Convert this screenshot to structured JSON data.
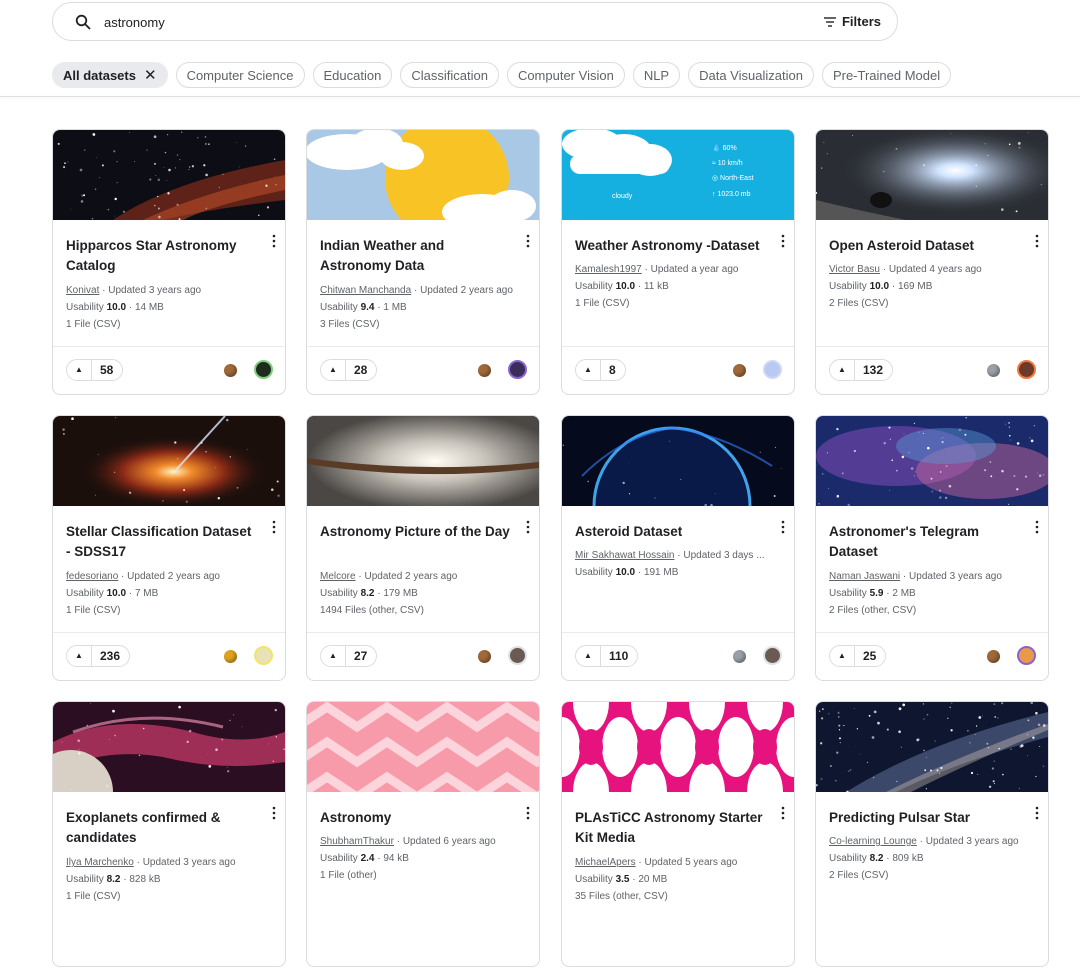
{
  "search": {
    "query": "astronomy",
    "filters_label": "Filters"
  },
  "chips": [
    {
      "label": "All datasets",
      "active": true
    },
    {
      "label": "Computer Science"
    },
    {
      "label": "Education"
    },
    {
      "label": "Classification"
    },
    {
      "label": "Computer Vision"
    },
    {
      "label": "NLP"
    },
    {
      "label": "Data Visualization"
    },
    {
      "label": "Pre-Trained Model"
    }
  ],
  "colors": {
    "medal_bronze": "#a0693a",
    "medal_silver": "#9aa0a6",
    "medal_gold": "#e0a21e",
    "border": "#dadce0"
  },
  "weather_overlay": [
    "60%",
    "10 km/h",
    "North-East",
    "1023.0 mb",
    "cloudy"
  ],
  "cards": [
    {
      "title": "Hipparcos Star Astronomy Catalog",
      "owner": "Konivat",
      "updated": "Updated 3 years ago",
      "usability_label": "Usability",
      "usability": "10.0",
      "size": "14 MB",
      "files": "1 File (CSV)",
      "votes": "58",
      "medal": "bronze",
      "thumb": "stars",
      "avatar": "dark-green-avatar"
    },
    {
      "title": "Indian Weather and Astronomy Data",
      "owner": "Chitwan Manchanda",
      "updated": "Updated 2 years ago",
      "usability_label": "Usability",
      "usability": "9.4",
      "size": "1 MB",
      "files": "3 Files (CSV)",
      "votes": "28",
      "medal": "bronze",
      "thumb": "sun-clouds",
      "avatar": "purple-avatar"
    },
    {
      "title": "Weather Astronomy -Dataset",
      "owner": "Kamalesh1997",
      "updated": "Updated a year ago",
      "usability_label": "Usability",
      "usability": "10.0",
      "size": "11 kB",
      "files": "1 File (CSV)",
      "votes": "8",
      "medal": "bronze",
      "thumb": "weather-widget",
      "avatar": "blue-avatar"
    },
    {
      "title": "Open Asteroid Dataset",
      "owner": "Victor Basu",
      "updated": "Updated 4 years ago",
      "usability_label": "Usability",
      "usability": "10.0",
      "size": "169 MB",
      "files": "2 Files (CSV)",
      "votes": "132",
      "medal": "silver",
      "thumb": "asteroid",
      "avatar": "orange-avatar"
    },
    {
      "title": "Stellar Classification Dataset - SDSS17",
      "owner": "fedesoriano",
      "updated": "Updated 2 years ago",
      "usability_label": "Usability",
      "usability": "10.0",
      "size": "7 MB",
      "files": "1 File (CSV)",
      "votes": "236",
      "medal": "gold",
      "thumb": "black-hole",
      "avatar": "yellow-avatar"
    },
    {
      "title": "Astronomy Picture of the Day",
      "owner": "Melcore",
      "updated": "Updated 2 years ago",
      "usability_label": "Usability",
      "usability": "8.2",
      "size": "179 MB",
      "files": "1494 Files (other, CSV)",
      "votes": "27",
      "medal": "bronze",
      "thumb": "galaxy-edge",
      "avatar": "portrait-avatar"
    },
    {
      "title": "Asteroid Dataset",
      "owner": "Mir Sakhawat Hossain",
      "updated": "Updated 3 days ...",
      "usability_label": "Usability",
      "usability": "10.0",
      "size": "191 MB",
      "files": "",
      "votes": "110",
      "medal": "silver",
      "thumb": "blue-planet",
      "avatar": "portrait-avatar"
    },
    {
      "title": "Astronomer's Telegram Dataset",
      "owner": "Naman Jaswani",
      "updated": "Updated 3 years ago",
      "usability_label": "Usability",
      "usability": "5.9",
      "size": "2 MB",
      "files": "2 Files (other, CSV)",
      "votes": "25",
      "medal": "bronze",
      "thumb": "nebula",
      "avatar": "sunset-avatar"
    },
    {
      "title": "Exoplanets confirmed & candidates",
      "owner": "Ilya Marchenko",
      "updated": "Updated 3 years ago",
      "usability_label": "Usability",
      "usability": "8.2",
      "size": "828 kB",
      "files": "1 File (CSV)",
      "votes": "",
      "medal": "",
      "thumb": "exoplanet",
      "avatar": ""
    },
    {
      "title": "Astronomy",
      "owner": "ShubhamThakur",
      "updated": "Updated 6 years ago",
      "usability_label": "Usability",
      "usability": "2.4",
      "size": "94 kB",
      "files": "1 File (other)",
      "votes": "",
      "medal": "",
      "thumb": "pink-pattern",
      "avatar": ""
    },
    {
      "title": "PLAsTiCC Astronomy Starter Kit Media",
      "owner": "MichaelApers",
      "updated": "Updated 5 years ago",
      "usability_label": "Usability",
      "usability": "3.5",
      "size": "20 MB",
      "files": "35 Files (other, CSV)",
      "votes": "",
      "medal": "",
      "thumb": "magenta-pattern",
      "avatar": ""
    },
    {
      "title": "Predicting Pulsar Star",
      "owner": "Co-learning Lounge",
      "updated": "Updated 3 years ago",
      "usability_label": "Usability",
      "usability": "8.2",
      "size": "809 kB",
      "files": "2 Files (CSV)",
      "votes": "",
      "medal": "",
      "thumb": "milky-way",
      "avatar": ""
    }
  ]
}
